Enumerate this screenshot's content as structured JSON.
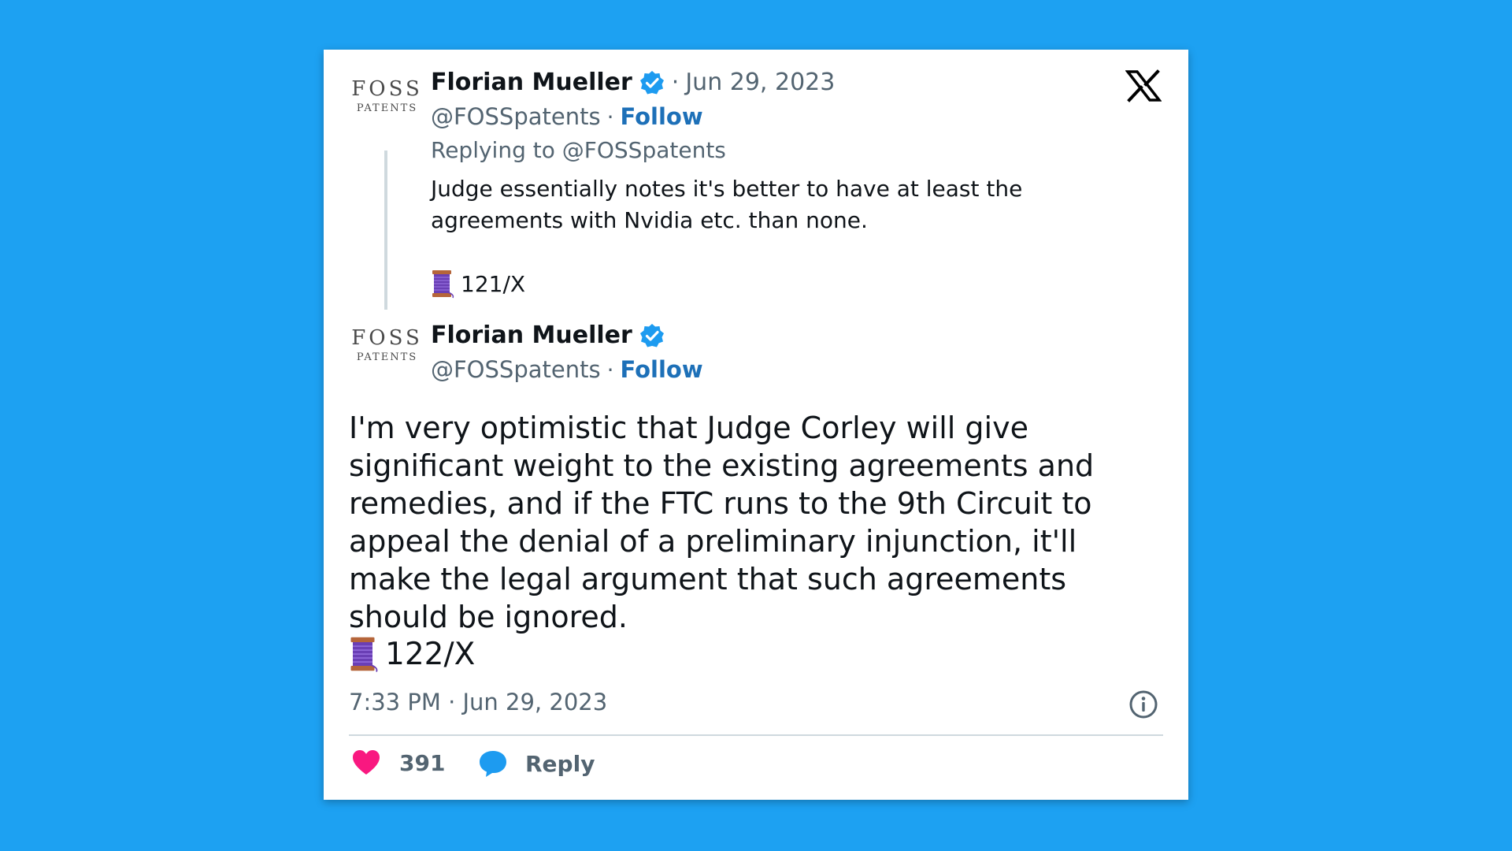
{
  "avatar": {
    "line1": "FOSS",
    "line2": "PATENTS"
  },
  "quoted": {
    "name": "Florian Mueller",
    "sep": "·",
    "date": "Jun 29, 2023",
    "handle": "@FOSSpatents",
    "follow": "Follow",
    "replying": "Replying to @FOSSpatents",
    "text": "Judge essentially notes it's better to have at least the agreements with Nvidia etc. than none.",
    "thread_num": "121/X"
  },
  "main": {
    "name": "Florian Mueller",
    "sep": "·",
    "handle": "@FOSSpatents",
    "follow": "Follow",
    "text": "I'm very optimistic that Judge Corley will give significant weight to the existing agreements and remedies, and if the FTC runs to the 9th Circuit to appeal the denial of a preliminary injunction, it'll make the legal argument that such agreements should be ignored.",
    "thread_num": "122/X",
    "timestamp": "7:33 PM · Jun 29, 2023"
  },
  "actions": {
    "likes": "391",
    "reply": "Reply"
  },
  "icons": {
    "close": "x-logo-icon",
    "verified": "verified-badge-icon",
    "spool": "spool-of-thread-icon",
    "info": "info-icon",
    "heart": "heart-icon",
    "reply": "reply-bubble-icon"
  },
  "colors": {
    "background": "#1DA1F2",
    "verified": "#1D9BF0",
    "follow": "#1D70B8",
    "heart": "#F91880",
    "reply_bubble": "#1D9BF0"
  }
}
